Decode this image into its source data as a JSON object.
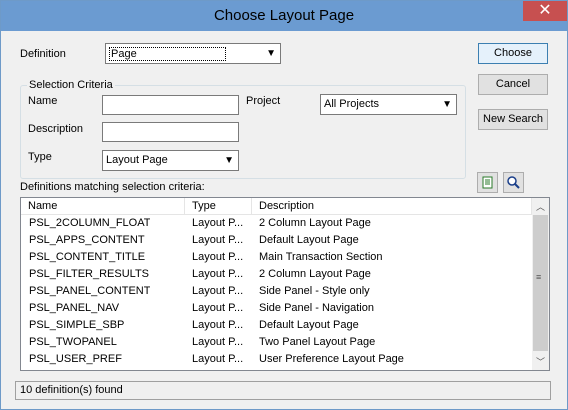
{
  "window": {
    "title": "Choose Layout Page",
    "close_label": "✕"
  },
  "form": {
    "definition_label": "Definition",
    "definition_value": "Page",
    "selection_criteria_label": "Selection Criteria",
    "name_label": "Name",
    "name_value": "",
    "description_label": "Description",
    "description_value": "",
    "type_label": "Type",
    "type_value": "Layout Page",
    "project_label": "Project",
    "project_value": "All Projects"
  },
  "buttons": {
    "choose": "Choose",
    "cancel": "Cancel",
    "new_search": "New Search"
  },
  "list": {
    "caption": "Definitions matching selection criteria:",
    "columns": [
      "Name",
      "Type",
      "Description"
    ],
    "rows": [
      [
        "PSL_2COLUMN_FLOAT",
        "Layout P...",
        "2 Column Layout Page"
      ],
      [
        "PSL_APPS_CONTENT",
        "Layout P...",
        "Default Layout Page"
      ],
      [
        "PSL_CONTENT_TITLE",
        "Layout P...",
        "Main Transaction Section"
      ],
      [
        "PSL_FILTER_RESULTS",
        "Layout P...",
        "2 Column Layout Page"
      ],
      [
        "PSL_PANEL_CONTENT",
        "Layout P...",
        "Side Panel - Style only"
      ],
      [
        "PSL_PANEL_NAV",
        "Layout P...",
        "Side Panel - Navigation"
      ],
      [
        "PSL_SIMPLE_SBP",
        "Layout P...",
        "Default Layout Page"
      ],
      [
        "PSL_TWOPANEL",
        "Layout P...",
        "Two Panel Layout Page"
      ],
      [
        "PSL_USER_PREF",
        "Layout P...",
        "User Preference Layout Page"
      ]
    ]
  },
  "status": {
    "text": "10 definition(s) found"
  }
}
